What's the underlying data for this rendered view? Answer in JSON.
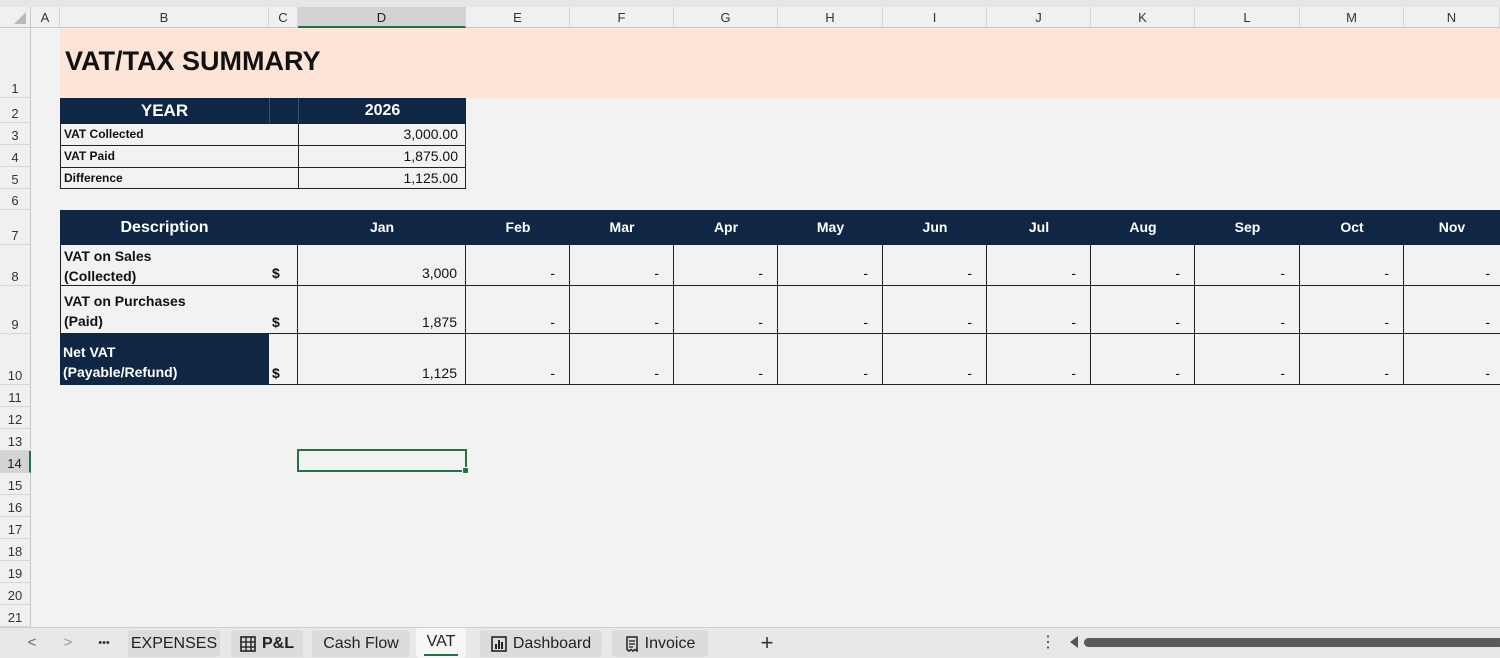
{
  "columns": [
    "A",
    "B",
    "C",
    "D",
    "E",
    "F",
    "G",
    "H",
    "I",
    "J",
    "K",
    "L",
    "M",
    "N"
  ],
  "rows": [
    "1",
    "2",
    "3",
    "4",
    "5",
    "6",
    "7",
    "8",
    "9",
    "10",
    "11",
    "12",
    "13",
    "14",
    "15",
    "16",
    "17",
    "18",
    "19",
    "20",
    "21"
  ],
  "title": "VAT/TAX SUMMARY",
  "summary": {
    "year_label": "YEAR",
    "year_value": "2026",
    "rows": [
      {
        "label": "VAT Collected",
        "value": "3,000.00"
      },
      {
        "label": "VAT Paid",
        "value": "1,875.00"
      },
      {
        "label": "Difference",
        "value": "1,125.00"
      }
    ]
  },
  "table": {
    "desc_header": "Description",
    "months": [
      "Jan",
      "Feb",
      "Mar",
      "Apr",
      "May",
      "Jun",
      "Jul",
      "Aug",
      "Sep",
      "Oct",
      "Nov"
    ],
    "rows": [
      {
        "line1": "VAT  on  Sales",
        "line2": "(Collected)",
        "currency": "$",
        "jan": "3,000",
        "rest": "-"
      },
      {
        "line1": "VAT on Purchases",
        "line2": "(Paid)",
        "currency": "$",
        "jan": "1,875",
        "rest": "-"
      },
      {
        "line1": "Net VAT",
        "line2": "(Payable/Refund)",
        "currency": "$",
        "jan": "1,125",
        "rest": "-"
      }
    ]
  },
  "selected_cell": "D14",
  "sheet_tabs": {
    "nav_prev": "<",
    "nav_next": ">",
    "more": "•••",
    "tabs": [
      "EXPENSES",
      "P&L",
      "Cash Flow",
      "VAT",
      "Dashboard",
      "Invoice"
    ],
    "active": "VAT",
    "add": "+",
    "options": "⋮"
  },
  "colors": {
    "navy": "#0f2645",
    "title_band": "#fce4d6",
    "excel_green": "#217346"
  }
}
